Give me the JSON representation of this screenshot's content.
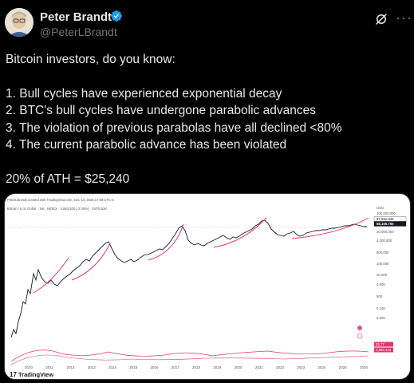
{
  "author": {
    "name": "Peter Brandt",
    "handle": "@PeterLBrandt",
    "verified_color": "#1d9bf0"
  },
  "tweet": {
    "line1": "Bitcoin investors, do you know:",
    "item1": "1. Bull cycles have experienced exponential decay",
    "item2": "2. BTC's bull cycles have undergone parabolic advances",
    "item3": "3. The violation of previous parabolas have all declined <80%",
    "item4": "4. The current parabolic advance has been violated",
    "closing": "20% of ATH = $25,240"
  },
  "chart": {
    "watermark": "TradingView",
    "caption": "PeterLBrandt created with TradingView.com, Dec 14, 2025 17:08 UTC-5",
    "symbol": "Bitcoin / U.S. Dollar · 1W · INDEX · 4,863.100 (-2.06%) · Vol78.52K",
    "currency": "USD",
    "price_labels": [
      "100,000,000",
      "97,541.443",
      "88,165.750",
      "20,000,000",
      "4,000,000",
      "800,000",
      "100,000",
      "20,000",
      "4,000",
      "800",
      "0.100",
      "0.020"
    ],
    "indicator_labels": [
      "25.77",
      "4,866.415"
    ],
    "years": [
      "2010",
      "2011",
      "2012",
      "2013",
      "2014",
      "2015",
      "2016",
      "2017",
      "2018",
      "2019",
      "2020",
      "2021",
      "2022",
      "2023",
      "2024",
      "2025",
      "2026"
    ],
    "parabola_color": "#e8336d",
    "price_color": "#131722"
  }
}
